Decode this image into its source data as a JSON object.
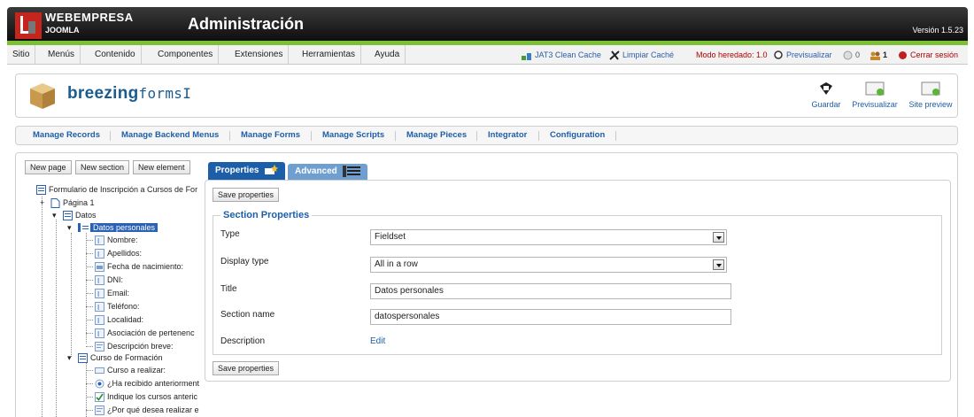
{
  "header": {
    "brand_top": "WEBEMPRESA",
    "brand_bottom": "JOOMLA",
    "title": "Administración",
    "version": "Versión 1.5.23"
  },
  "menu": {
    "items": [
      "Sitio",
      "Menús",
      "Contenido",
      "Componentes",
      "Extensiones",
      "Herramientas",
      "Ayuda"
    ],
    "clean_cache": "JAT3 Clean Cache",
    "limpiar_cache": "Limpiar Caché",
    "modo": "Modo heredado: 1.0",
    "previsualizar": "Previsualizar",
    "messages_count": "0",
    "users_count": "1",
    "logout": "Cerrar sesión"
  },
  "component": {
    "logo_bold": "breezing",
    "logo_thin": "forms",
    "toolbar": [
      "Guardar",
      "Previsualizar",
      "Site preview"
    ]
  },
  "subnav": [
    "Manage Records",
    "Manage Backend Menus",
    "Manage Forms",
    "Manage Scripts",
    "Manage Pieces",
    "Integrator",
    "Configuration"
  ],
  "tree_buttons": [
    "New page",
    "New section",
    "New element"
  ],
  "tree": {
    "root": "Formulario de Inscripción a Cursos de For",
    "page": "Página 1",
    "section1": "Datos",
    "section2": "Datos personales",
    "fields1": [
      "Nombre:",
      "Apellidos:",
      "Fecha de nacimiento:",
      "DNI:",
      "Email:",
      "Teléfono:",
      "Localidad:",
      "Asociación de pertenenc",
      "Descripción breve:"
    ],
    "section3": "Curso de Formación",
    "fields2": [
      "Curso a realizar:",
      "¿Ha recibido anteriorment",
      "Indique los cursos anteric",
      "¿Por qué desea realizar e"
    ]
  },
  "tabs": {
    "properties": "Properties",
    "advanced": "Advanced"
  },
  "form": {
    "save_top": "Save properties",
    "save_bottom": "Save properties",
    "legend": "Section Properties",
    "type_label": "Type",
    "type_value": "Fieldset",
    "display_label": "Display type",
    "display_value": "All in a row",
    "title_label": "Title",
    "title_value": "Datos personales",
    "section_name_label": "Section name",
    "section_name_value": "datospersonales",
    "description_label": "Description",
    "description_link": "Edit"
  }
}
